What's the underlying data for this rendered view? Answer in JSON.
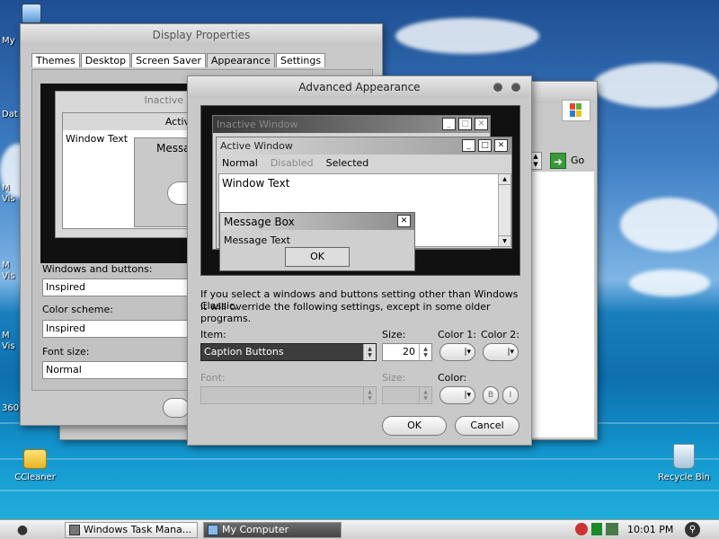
{
  "desktop": {
    "icons": [
      {
        "label": "CCleaner"
      },
      {
        "label": "Recycle Bin"
      }
    ],
    "edge_labels": [
      "My",
      "Dat",
      "M",
      "Vis",
      "M",
      "Vis",
      "M",
      "Vis",
      "360"
    ]
  },
  "display_properties": {
    "title": "Display Properties",
    "tabs": [
      "Themes",
      "Desktop",
      "Screen Saver",
      "Appearance",
      "Settings"
    ],
    "active_tab": "Appearance",
    "preview": {
      "inactive_title": "Inactive Windo",
      "active_title": "Active Win",
      "window_text": "Window Text",
      "message_title": "Messag"
    },
    "windows_buttons_label": "Windows and buttons:",
    "windows_buttons_value": "Inspired",
    "color_scheme_label": "Color scheme:",
    "color_scheme_value": "Inspired",
    "font_size_label": "Font size:",
    "font_size_value": "Normal"
  },
  "my_computer": {
    "go_label": "Go"
  },
  "advanced_appearance": {
    "title": "Advanced Appearance",
    "preview": {
      "inactive_title": "Inactive Window",
      "active_title": "Active Window",
      "menu": [
        "Normal",
        "Disabled",
        "Selected"
      ],
      "window_text": "Window Text",
      "message_box_title": "Message Box",
      "message_text": "Message Text",
      "ok": "OK"
    },
    "info_text_1": "If you select a windows and buttons setting other than Windows Classic,",
    "info_text_2": "it will override the following settings, except in some older programs.",
    "item_label": "Item:",
    "item_value": "Caption Buttons",
    "size_label": "Size:",
    "size_value": "20",
    "color1_label": "Color 1:",
    "color2_label": "Color 2:",
    "font_label": "Font:",
    "font_size_label": "Size:",
    "font_color_label": "Color:",
    "bold_label": "B",
    "italic_label": "I",
    "ok_label": "OK",
    "cancel_label": "Cancel"
  },
  "taskbar": {
    "tasks": [
      {
        "label": "Windows Task Mana..."
      },
      {
        "label": "My Computer"
      }
    ],
    "clock": "10:01 PM"
  }
}
